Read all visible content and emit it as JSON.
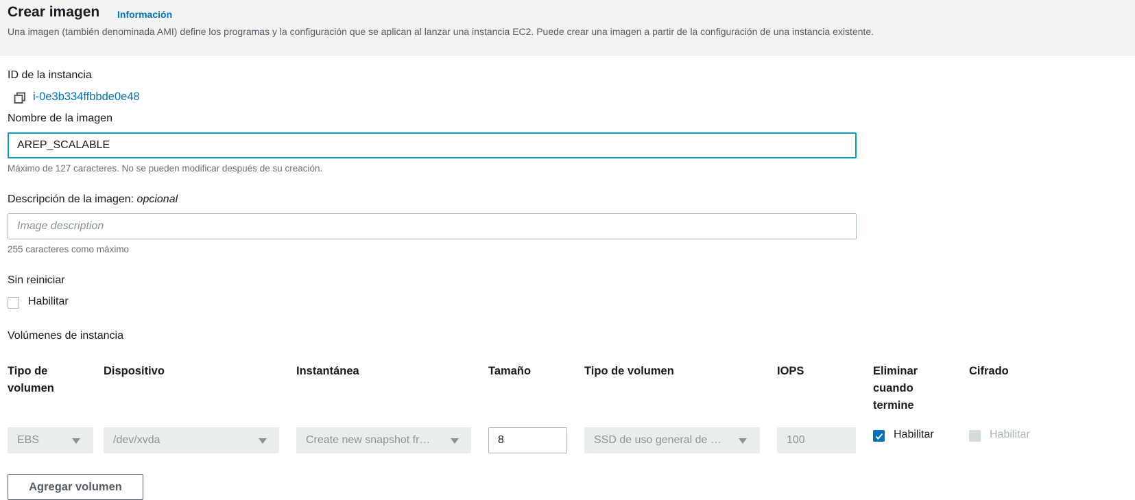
{
  "header": {
    "title": "Crear imagen",
    "info_link": "Información",
    "subtitle": "Una imagen (también denominada AMI) define los programas y la configuración que se aplican al lanzar una instancia EC2. Puede crear una imagen a partir de la configuración de una instancia existente."
  },
  "instance": {
    "label": "ID de la instancia",
    "id": "i-0e3b334ffbbde0e48"
  },
  "image_name": {
    "label": "Nombre de la imagen",
    "value": "AREP_SCALABLE",
    "hint": "Máximo de 127 caracteres. No se pueden modificar después de su creación."
  },
  "image_description": {
    "label": "Descripción de la imagen:",
    "optional": "opcional",
    "placeholder": "Image description",
    "hint": "255 caracteres como máximo"
  },
  "no_reboot": {
    "label": "Sin reiniciar",
    "option": "Habilitar",
    "checked": false
  },
  "volumes": {
    "section_label": "Volúmenes de instancia",
    "columns": {
      "volume_type": "Tipo de volumen",
      "device": "Dispositivo",
      "snapshot": "Instantánea",
      "size": "Tamaño",
      "volume_kind": "Tipo de volumen",
      "iops": "IOPS",
      "delete_on_termination": "Eliminar cuando termine",
      "encrypted": "Cifrado"
    },
    "row": {
      "volume_type": "EBS",
      "device": "/dev/xvda",
      "snapshot": "Create new snapshot fr…",
      "size": "8",
      "volume_kind": "SSD de uso general de …",
      "iops": "100",
      "delete_on_termination_label": "Habilitar",
      "delete_on_termination_checked": true,
      "encrypted_label": "Habilitar",
      "encrypted_checked": false
    },
    "add_button": "Agregar volumen"
  },
  "colors": {
    "link": "#0073bb",
    "focus": "#00a1c9",
    "disabled_bg": "#eaeded",
    "header_bg": "#f2f3f3"
  }
}
